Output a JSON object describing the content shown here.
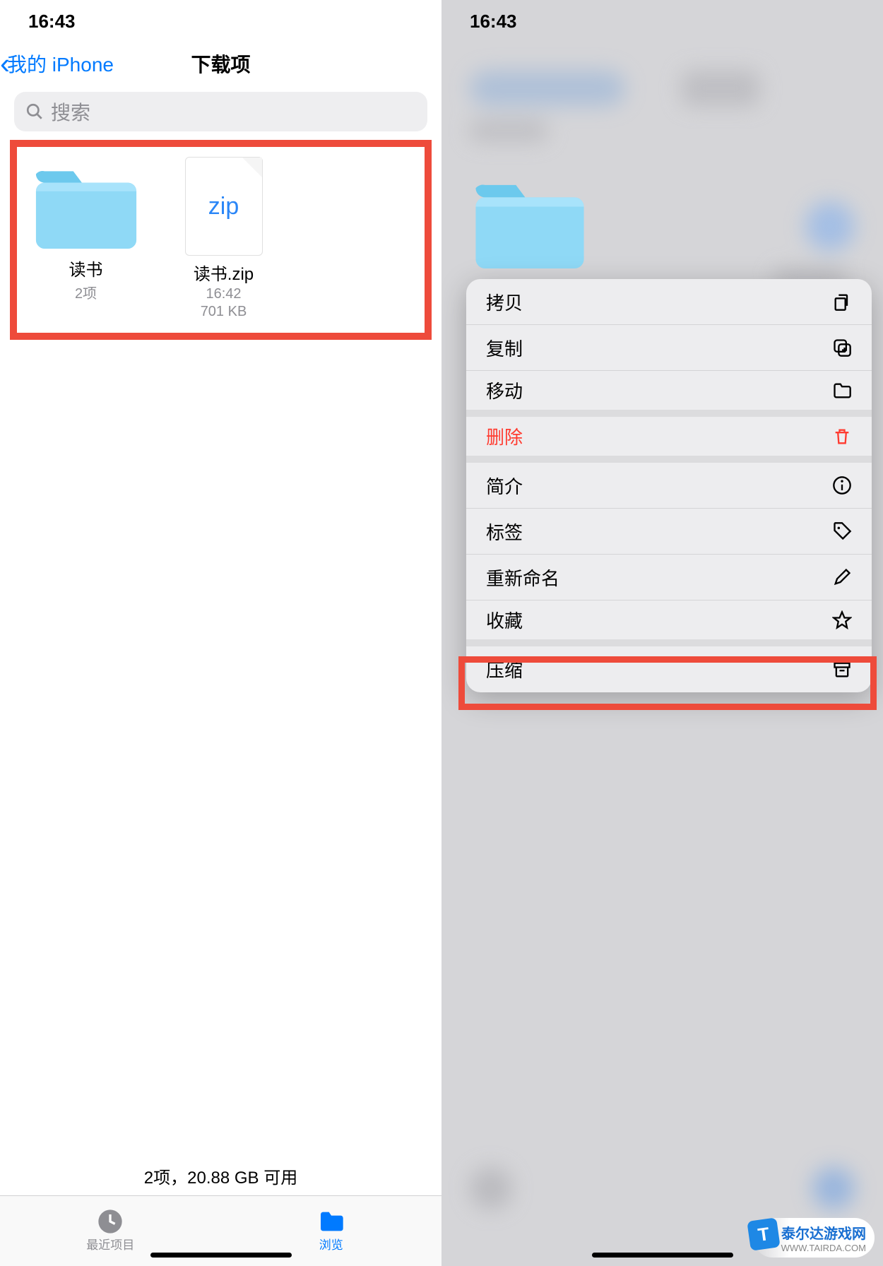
{
  "left": {
    "status_time": "16:43",
    "back_label": "我的 iPhone",
    "nav_title": "下载项",
    "search_placeholder": "搜索",
    "items": [
      {
        "name": "读书",
        "meta1": "2项",
        "meta2": ""
      },
      {
        "name": "读书.zip",
        "meta1": "16:42",
        "meta2": "701 KB",
        "badge": "zip"
      }
    ],
    "footer": "2项，20.88 GB 可用",
    "tabs": {
      "recent": "最近项目",
      "browse": "浏览"
    }
  },
  "right": {
    "status_time": "16:43",
    "menu": [
      {
        "label": "拷贝",
        "icon": "copy"
      },
      {
        "label": "复制",
        "icon": "duplicate"
      },
      {
        "label": "移动",
        "icon": "folder",
        "sep": true
      },
      {
        "label": "删除",
        "icon": "trash",
        "destructive": true,
        "sep": true
      },
      {
        "label": "简介",
        "icon": "info"
      },
      {
        "label": "标签",
        "icon": "tag"
      },
      {
        "label": "重新命名",
        "icon": "pencil"
      },
      {
        "label": "收藏",
        "icon": "star",
        "sep": true
      },
      {
        "label": "压缩",
        "icon": "archive",
        "highlighted": true
      }
    ]
  },
  "watermark": {
    "line1": "泰尔达游戏网",
    "line2": "WWW.TAIRDA.COM",
    "badge": "T"
  }
}
